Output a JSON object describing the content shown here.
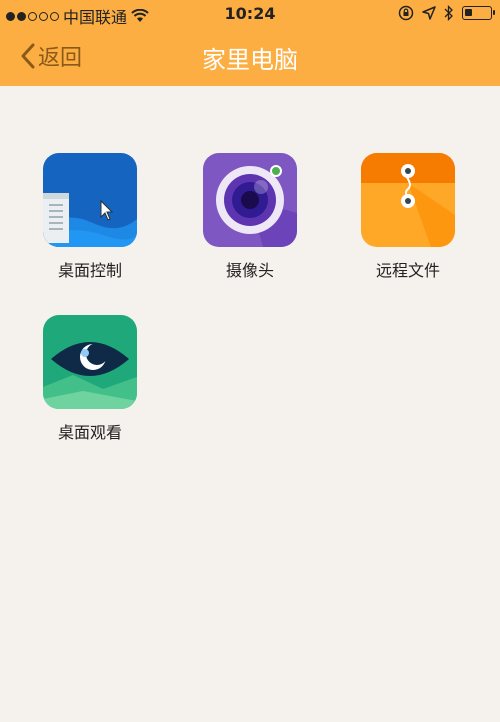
{
  "status_bar": {
    "carrier": "中国联通",
    "time": "10:24"
  },
  "nav": {
    "back_label": "返回",
    "title": "家里电脑"
  },
  "apps": [
    {
      "label": "桌面控制",
      "icon": "desktop-control-icon",
      "color": "#1565c0"
    },
    {
      "label": "摄像头",
      "icon": "camera-icon",
      "color": "#7e57c2"
    },
    {
      "label": "远程文件",
      "icon": "remote-file-icon",
      "color": "#ff9800"
    },
    {
      "label": "桌面观看",
      "icon": "desktop-view-icon",
      "color": "#1fa97a"
    }
  ],
  "colors": {
    "accent": "#fcae42",
    "background": "#f5f1ec"
  }
}
